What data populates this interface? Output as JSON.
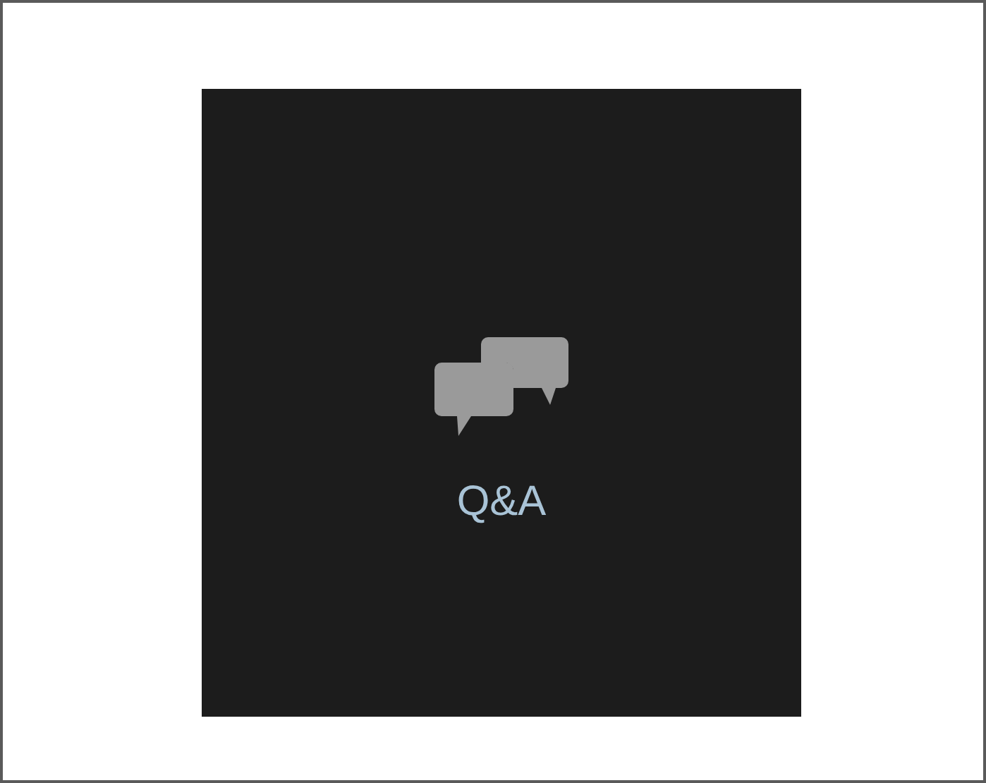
{
  "button": {
    "label": "Q&A"
  }
}
